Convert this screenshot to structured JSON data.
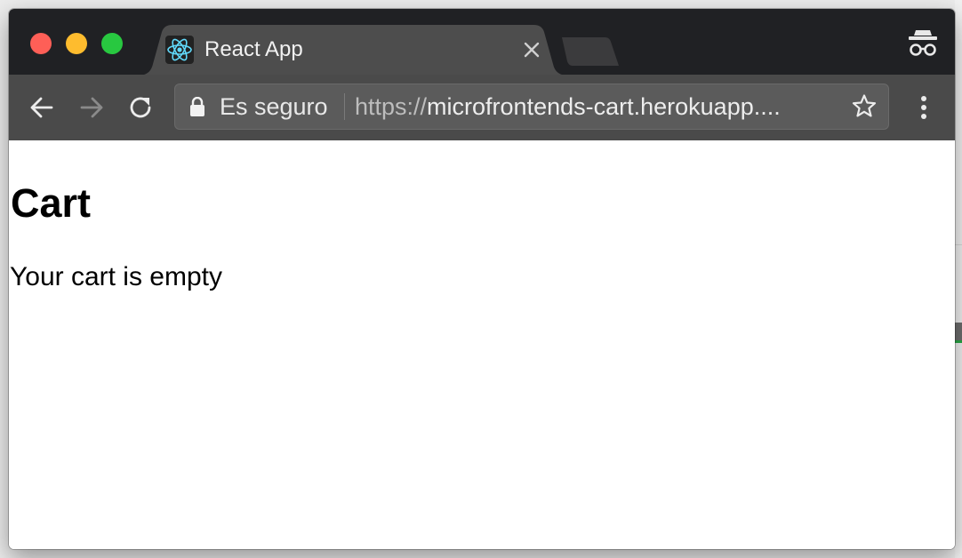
{
  "browser": {
    "tab": {
      "title": "React App"
    },
    "omnibox": {
      "security_label": "Es seguro",
      "url_scheme": "https://",
      "url_rest": "microfrontends-cart.herokuapp...."
    },
    "colors": {
      "titlebar": "#202124",
      "toolbar": "#4a4a4a",
      "tab": "#4d4d4d"
    },
    "icons": [
      "back-arrow-icon",
      "forward-arrow-icon",
      "reload-icon",
      "lock-icon",
      "star-icon",
      "menu-dots-icon",
      "incognito-icon",
      "react-logo-icon",
      "close-icon"
    ]
  },
  "page": {
    "heading": "Cart",
    "message": "Your cart is empty"
  }
}
